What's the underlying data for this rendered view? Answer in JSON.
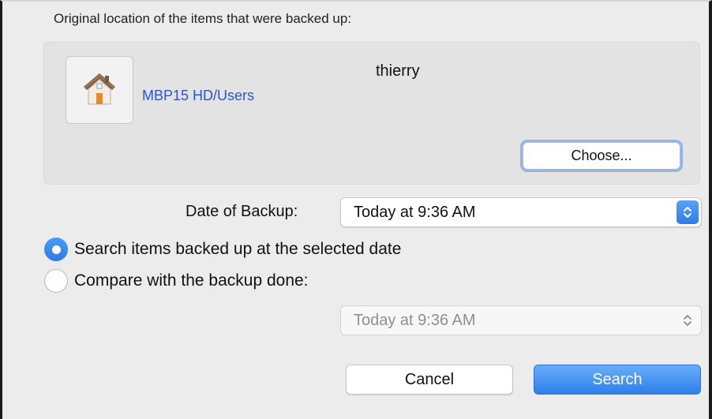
{
  "location": {
    "label": "Original location of the items that were backed up:",
    "path": "MBP15 HD/Users",
    "user": "thierry",
    "choose_label": "Choose...",
    "icon": "home-icon"
  },
  "date": {
    "label": "Date of Backup:",
    "value": "Today at 9:36 AM"
  },
  "options": {
    "search_label": "Search items backed up at the selected date",
    "compare_label": "Compare with the backup done:",
    "selected": "search",
    "compare_value": "Today at 9:36 AM"
  },
  "buttons": {
    "cancel": "Cancel",
    "search": "Search"
  },
  "colors": {
    "accent": "#2e7fe9",
    "link": "#2a56d6",
    "dialog_bg": "#ececec"
  }
}
